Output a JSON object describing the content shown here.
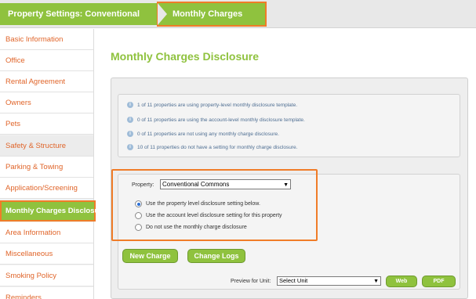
{
  "breadcrumb": {
    "items": [
      "Property Settings: Conventional Commons",
      "Monthly Charges Disclosure"
    ]
  },
  "sidebar": {
    "items": [
      {
        "label": "Basic Information"
      },
      {
        "label": "Office"
      },
      {
        "label": "Rental Agreement"
      },
      {
        "label": "Owners"
      },
      {
        "label": "Pets"
      },
      {
        "label": "Safety & Structure"
      },
      {
        "label": "Parking & Towing"
      },
      {
        "label": "Application/Screening"
      },
      {
        "label": "Monthly Charges Disclosure"
      },
      {
        "label": "Area Information"
      },
      {
        "label": "Miscellaneous"
      },
      {
        "label": "Smoking Policy"
      },
      {
        "label": "Reminders"
      }
    ],
    "active_index": 8
  },
  "main": {
    "title": "Monthly Charges Disclosure",
    "info": [
      "1 of 11 properties are using property-level monthly disclosure template.",
      "0 of 11 properties are using the account-level monthly disclosure template.",
      "0 of 11 properties are not using any monthly charge disclosure.",
      "10 of 11 properties do not have a setting for monthly charge disclosure."
    ],
    "info_icon": "i",
    "property_label": "Property:",
    "property_value": "Conventional Commons",
    "radio_options": [
      {
        "label": "Use the property level disclosure setting below.",
        "checked": true
      },
      {
        "label": "Use the account level disclosure setting for this property",
        "checked": false
      },
      {
        "label": "Do not use the monthly charge disclosure",
        "checked": false
      }
    ],
    "buttons": {
      "new_charge": "New Charge",
      "change_logs": "Change Logs",
      "web": "Web",
      "pdf": "PDF"
    },
    "preview_label": "Preview for Unit:",
    "unit_select_value": "Select Unit"
  },
  "colors": {
    "accent_green": "#8fc23e",
    "highlight_orange": "#f07c28",
    "link_orange": "#e0652a"
  }
}
